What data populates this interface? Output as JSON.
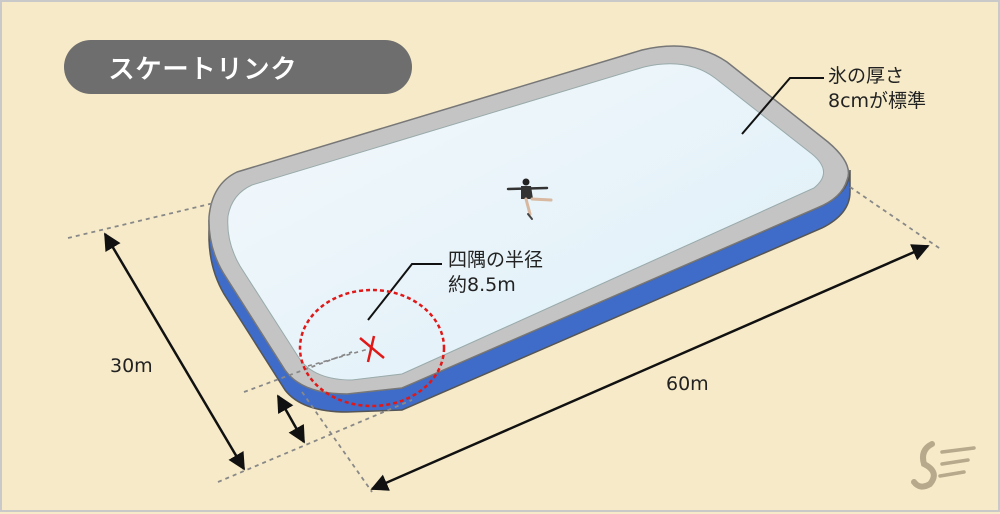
{
  "title": "スケートリンク",
  "annotations": {
    "ice_thickness_line1": "氷の厚さ",
    "ice_thickness_line2": "8cmが標準",
    "corner_radius_line1": "四隅の半径",
    "corner_radius_line2": "約8.5m"
  },
  "dimensions": {
    "width_label": "30m",
    "length_label": "60m"
  },
  "colors": {
    "background": "#f6eac8",
    "ice": "#eef6fb",
    "rim": "#bfbfbf",
    "side": "#3f6cc8",
    "radius_marker": "#e01818",
    "pill": "#6e6e6e"
  },
  "icons": {
    "figure": "figure-skater-icon",
    "logo": "sports-logo-icon"
  }
}
